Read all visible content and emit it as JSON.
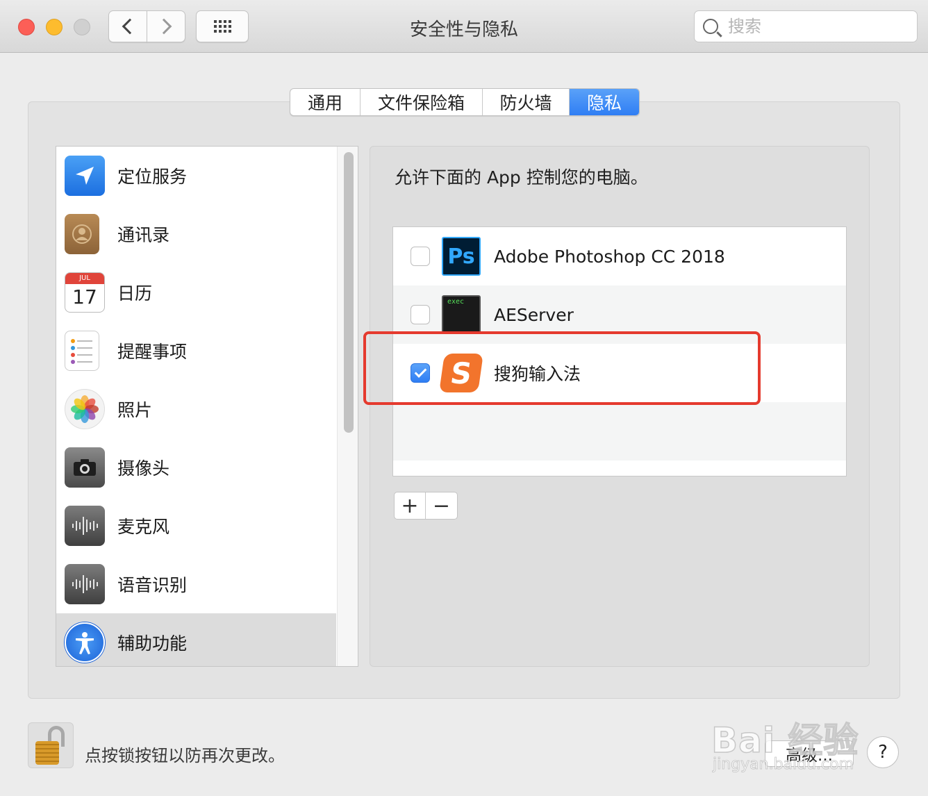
{
  "window": {
    "title": "安全性与隐私"
  },
  "search": {
    "placeholder": "搜索"
  },
  "tabs": [
    {
      "label": "通用",
      "active": false
    },
    {
      "label": "文件保险箱",
      "active": false
    },
    {
      "label": "防火墙",
      "active": false
    },
    {
      "label": "隐私",
      "active": true
    }
  ],
  "sidebar": {
    "items": [
      {
        "label": "定位服务",
        "icon": "location-arrow-icon"
      },
      {
        "label": "通讯录",
        "icon": "contacts-book-icon"
      },
      {
        "label": "日历",
        "icon": "calendar-icon",
        "month": "JUL",
        "day": "17"
      },
      {
        "label": "提醒事项",
        "icon": "reminders-list-icon"
      },
      {
        "label": "照片",
        "icon": "photos-flower-icon"
      },
      {
        "label": "摄像头",
        "icon": "camera-icon"
      },
      {
        "label": "麦克风",
        "icon": "microphone-waveform-icon"
      },
      {
        "label": "语音识别",
        "icon": "speech-waveform-icon"
      },
      {
        "label": "辅助功能",
        "icon": "accessibility-icon",
        "selected": true
      }
    ]
  },
  "panel": {
    "description": "允许下面的 App 控制您的电脑。",
    "apps": [
      {
        "name": "Adobe Photoshop CC 2018",
        "checked": false,
        "icon_text": "Ps"
      },
      {
        "name": "AEServer",
        "checked": false,
        "icon_text": "exec"
      },
      {
        "name": "搜狗输入法",
        "checked": true,
        "icon_text": "S"
      }
    ],
    "add_label": "+",
    "remove_label": "−"
  },
  "footer": {
    "lock_text": "点按锁按钮以防再次更改。",
    "advanced_label": "高级...",
    "help_label": "?"
  },
  "watermark": {
    "text": "Bai 经验",
    "sub": "jingyan.baidu.com"
  },
  "colors": {
    "accent": "#2f7ef4",
    "highlight_box": "#e53a2e"
  }
}
